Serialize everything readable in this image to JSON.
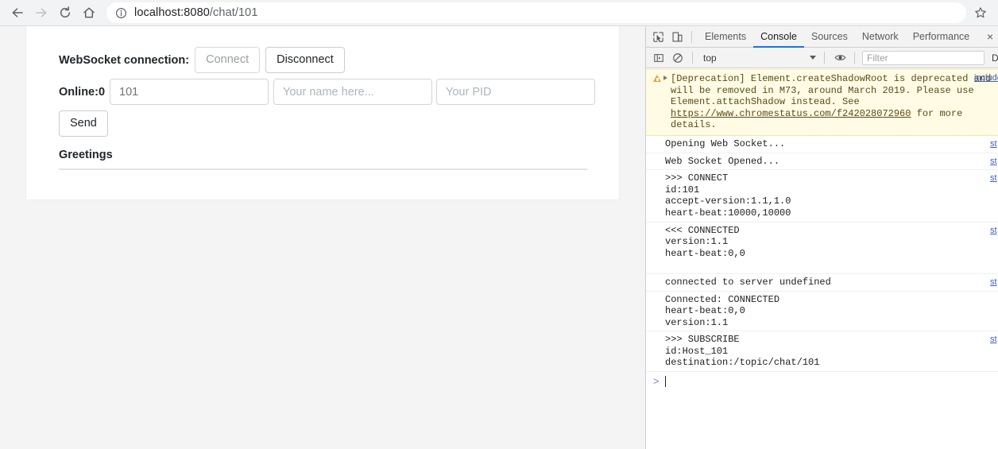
{
  "browser": {
    "nav": {
      "back_icon": "arrow-left-icon",
      "forward_icon": "arrow-right-icon",
      "reload_icon": "reload-icon",
      "home_icon": "home-icon"
    },
    "omnibox": {
      "info_icon": "page-info-icon",
      "url_host": "localhost:8080",
      "url_path": "/chat/101",
      "full_url": "localhost:8080/chat/101"
    },
    "bookmark_icon": "star-icon"
  },
  "page": {
    "websocket_label": "WebSocket connection:",
    "connect_button": "Connect",
    "disconnect_button": "Disconnect",
    "online_label": "Online:0",
    "id_value": "101",
    "name_placeholder": "Your name here...",
    "pid_placeholder": "Your PID",
    "send_button": "Send",
    "greetings_header": "Greetings"
  },
  "devtools": {
    "inspect_icon": "inspect-element-icon",
    "device_icon": "device-toolbar-icon",
    "tabs": [
      {
        "label": "Elements",
        "active": false
      },
      {
        "label": "Console",
        "active": true
      },
      {
        "label": "Sources",
        "active": false
      },
      {
        "label": "Network",
        "active": false
      },
      {
        "label": "Performance",
        "active": false
      }
    ],
    "tab_close": "×",
    "console_toolbar": {
      "sidebar_icon": "console-sidebar-icon",
      "clear_icon": "clear-console-icon",
      "context": "top",
      "eye_icon": "live-expression-icon",
      "filter_placeholder": "Filter",
      "level": "Default lev"
    },
    "messages": [
      {
        "type": "warning",
        "text": "[Deprecation] Element.createShadowRoot is deprecated and will be removed in M73, around March 2019. Please use Element.attachShadow instead. See ",
        "link": "https://www.chromestatus.com/f242028072960",
        "text_tail": " for more details.",
        "source": "include."
      },
      {
        "type": "log",
        "text": "Opening Web Socket...",
        "source": "st"
      },
      {
        "type": "log",
        "text": "Web Socket Opened...",
        "source": "st"
      },
      {
        "type": "log",
        "text": ">>> CONNECT\nid:101\naccept-version:1.1,1.0\nheart-beat:10000,10000\n",
        "source": "st"
      },
      {
        "type": "log",
        "text": "<<< CONNECTED\nversion:1.1\nheart-beat:0,0\n\n",
        "source": "st"
      },
      {
        "type": "log",
        "text": "connected to server undefined",
        "source": "st"
      },
      {
        "type": "log",
        "text": "Connected: CONNECTED\nheart-beat:0,0\nversion:1.1\n",
        "source": ""
      },
      {
        "type": "log",
        "text": ">>> SUBSCRIBE\nid:Host_101\ndestination:/topic/chat/101\n",
        "source": "st"
      }
    ],
    "prompt": ">"
  }
}
